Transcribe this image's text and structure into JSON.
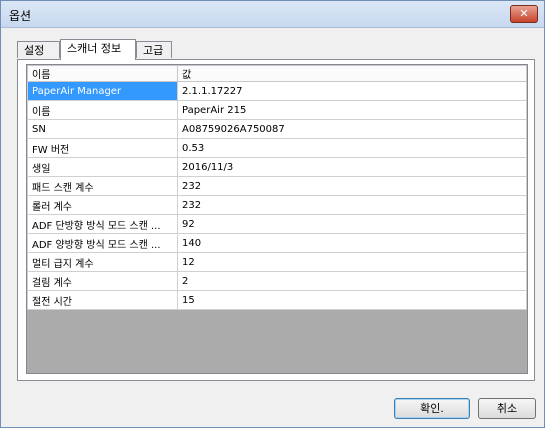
{
  "window": {
    "title": "옵션",
    "close_symbol": "✕"
  },
  "tabs": [
    {
      "label": "설정"
    },
    {
      "label": "스캐너 정보"
    },
    {
      "label": "고급"
    }
  ],
  "table": {
    "headers": [
      "이름",
      "값"
    ],
    "rows": [
      {
        "name": "PaperAir Manager",
        "value": "2.1.1.17227"
      },
      {
        "name": "이름",
        "value": "PaperAir 215"
      },
      {
        "name": "SN",
        "value": "A08759026A750087"
      },
      {
        "name": "FW 버전",
        "value": "0.53"
      },
      {
        "name": "생일",
        "value": "2016/11/3"
      },
      {
        "name": "패드 스캔 계수",
        "value": "232"
      },
      {
        "name": "롤러 계수",
        "value": "232"
      },
      {
        "name": "ADF 단방향 방식 모드 스캔 ...",
        "value": "92"
      },
      {
        "name": "ADF 양방향 방식 모드 스캔 ...",
        "value": "140"
      },
      {
        "name": "멀티 급지 계수",
        "value": "12"
      },
      {
        "name": "걸림 계수",
        "value": "2"
      },
      {
        "name": "절전 시간",
        "value": "15"
      }
    ]
  },
  "buttons": {
    "ok": "확인.",
    "cancel": "취소"
  }
}
